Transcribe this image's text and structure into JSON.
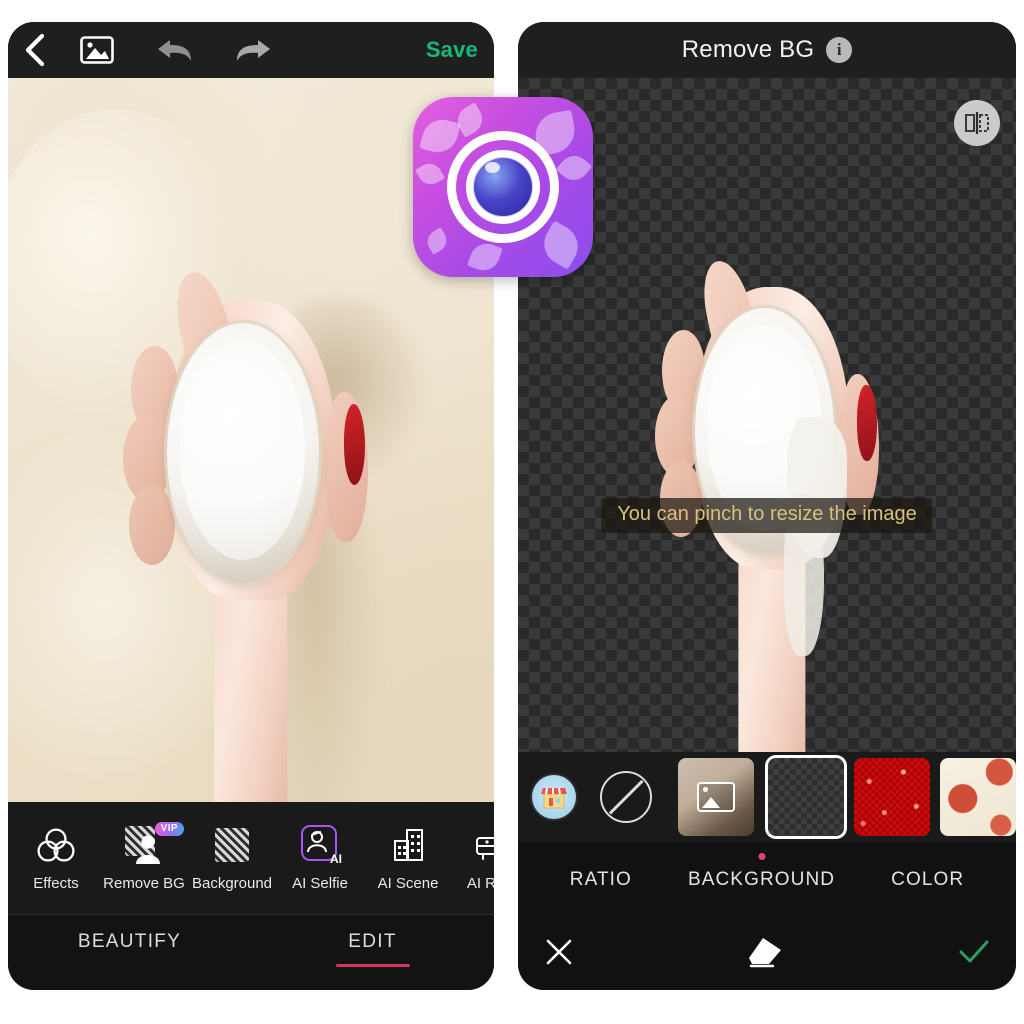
{
  "left_phone": {
    "topbar": {
      "back_icon": "back-chevron-icon",
      "gallery_icon": "image-icon",
      "undo_icon": "undo-arrow-icon",
      "redo_icon": "redo-arrow-icon",
      "save_label": "Save",
      "save_color": "#17b978"
    },
    "photo": {
      "subject": "hand holding jar of white cream on cream-colored background"
    },
    "tools": [
      {
        "label": "Effects",
        "icon": "three-circles-icon",
        "badge": ""
      },
      {
        "label": "Remove BG",
        "icon": "remove-bg-icon",
        "badge": "VIP"
      },
      {
        "label": "Background",
        "icon": "hatched-square-icon",
        "badge": ""
      },
      {
        "label": "AI Selfie",
        "icon": "ai-selfie-icon",
        "badge": ""
      },
      {
        "label": "AI Scene",
        "icon": "building-icon",
        "badge": ""
      },
      {
        "label": "AI Room",
        "icon": "sofa-icon",
        "badge": ""
      }
    ],
    "tabs": [
      {
        "label": "BEAUTIFY",
        "active": false
      },
      {
        "label": "EDIT",
        "active": true
      }
    ],
    "accent_color": "#d1355a"
  },
  "right_phone": {
    "topbar": {
      "title": "Remove BG",
      "info_icon": "info-icon",
      "info_glyph": "i"
    },
    "canvas": {
      "flip_icon": "flip-horizontal-icon",
      "toast": "You can pinch to resize the image",
      "toast_color": "#d9c07a",
      "background": "transparent-checkerboard"
    },
    "thumbnails": [
      {
        "name": "store",
        "label": "",
        "selected": false
      },
      {
        "name": "none",
        "label": "",
        "selected": false
      },
      {
        "name": "gallery",
        "label": "",
        "selected": false
      },
      {
        "name": "transparent",
        "label": "",
        "selected": true
      },
      {
        "name": "red-glitter",
        "label": "",
        "selected": false
      },
      {
        "name": "floral",
        "label": "",
        "selected": false
      }
    ],
    "tabs": [
      {
        "label": "RATIO",
        "active": false
      },
      {
        "label": "BACKGROUND",
        "active": true
      },
      {
        "label": "COLOR",
        "active": false
      }
    ],
    "tab_dot_color": "#e0456f",
    "actions": {
      "cancel_icon": "close-x-icon",
      "eraser_icon": "eraser-icon",
      "confirm_icon": "check-icon",
      "confirm_color": "#2f9e63"
    }
  },
  "app_icon": {
    "name": "beauty-camera-app-icon",
    "description": "purple gradient camera lens with cherry blossom petals"
  }
}
